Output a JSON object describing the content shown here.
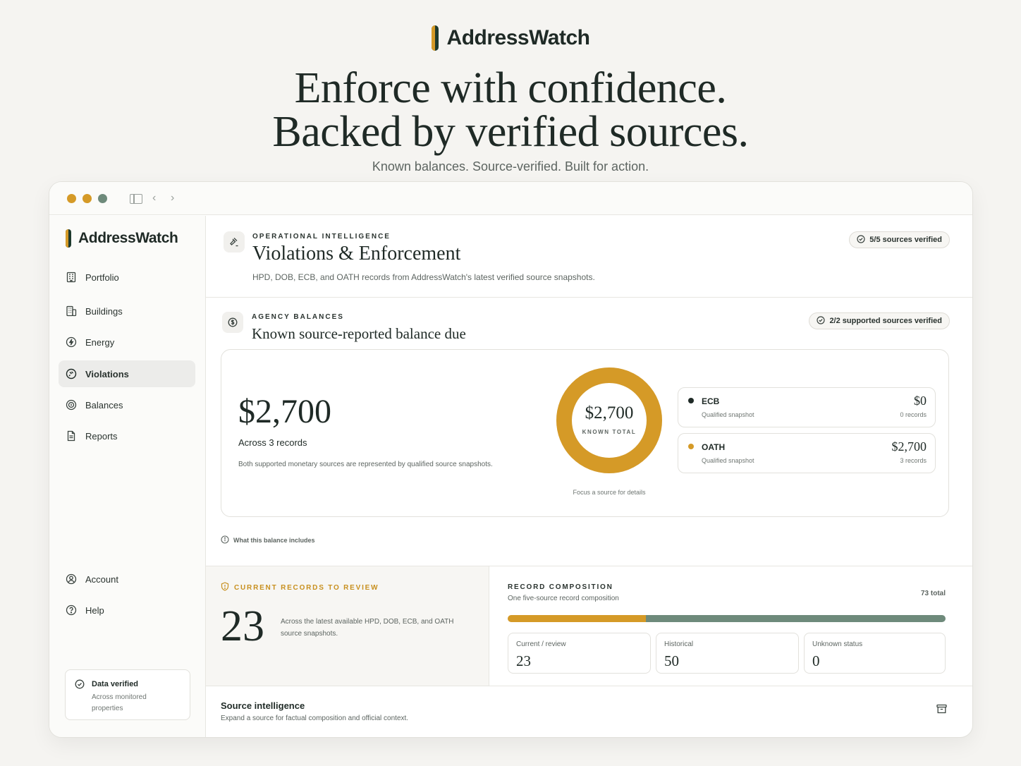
{
  "brand": {
    "name": "AddressWatch",
    "accent": "#d59a27",
    "dark": "#1e3a2e",
    "muted_green": "#6e8a7b"
  },
  "hero": {
    "line1": "Enforce with confidence.",
    "line2": "Backed by verified sources.",
    "subtitle": "Known balances. Source-verified. Built for action."
  },
  "sidebar": {
    "items": [
      {
        "label": "Portfolio",
        "icon": "building-icon"
      },
      {
        "label": "Buildings",
        "icon": "buildings-icon"
      },
      {
        "label": "Energy",
        "icon": "bolt-icon"
      },
      {
        "label": "Violations",
        "icon": "gavel-circle-icon",
        "active": true
      },
      {
        "label": "Balances",
        "icon": "coins-icon"
      },
      {
        "label": "Reports",
        "icon": "document-icon"
      }
    ],
    "footer_items": [
      {
        "label": "Account",
        "icon": "user-circle-icon"
      },
      {
        "label": "Help",
        "icon": "help-circle-icon"
      }
    ],
    "verified": {
      "title": "Data verified",
      "subtitle": "Across monitored properties"
    }
  },
  "header": {
    "eyebrow": "OPERATIONAL INTELLIGENCE",
    "title": "Violations & Enforcement",
    "description": "HPD, DOB, ECB, and OATH records from AddressWatch's latest verified source snapshots.",
    "badge": "5/5 sources verified"
  },
  "balances": {
    "eyebrow": "AGENCY BALANCES",
    "title": "Known source-reported balance due",
    "badge": "2/2 supported sources verified",
    "total": "$2,700",
    "across": "Across 3 records",
    "note": "Both supported monetary sources are represented by qualified source snapshots.",
    "donut_total": "$2,700",
    "donut_label": "KNOWN TOTAL",
    "focus_hint": "Focus a source for details",
    "sources": [
      {
        "name": "ECB",
        "sub": "Qualified snapshot",
        "amount": "$0",
        "records": "0 records",
        "value": 0,
        "color": "#1f2a26"
      },
      {
        "name": "OATH",
        "sub": "Qualified snapshot",
        "amount": "$2,700",
        "records": "3 records",
        "value": 2700,
        "color": "#d59a27"
      }
    ],
    "what_includes": "What this balance includes"
  },
  "records": {
    "eyebrow": "CURRENT RECORDS TO REVIEW",
    "count": "23",
    "description": "Across the latest available HPD, DOB, ECB, and OATH source snapshots."
  },
  "composition": {
    "eyebrow": "RECORD COMPOSITION",
    "subtitle": "One five-source record composition",
    "total": "73 total",
    "segments": [
      {
        "label": "Current / review",
        "value": 23,
        "display": "23",
        "color": "#d59a27"
      },
      {
        "label": "Historical",
        "value": 50,
        "display": "50",
        "color": "#6e8a7b"
      },
      {
        "label": "Unknown status",
        "value": 0,
        "display": "0",
        "color": "#bfbcb4"
      }
    ]
  },
  "source_intelligence": {
    "title": "Source intelligence",
    "subtitle": "Expand a source for factual composition and official context."
  }
}
